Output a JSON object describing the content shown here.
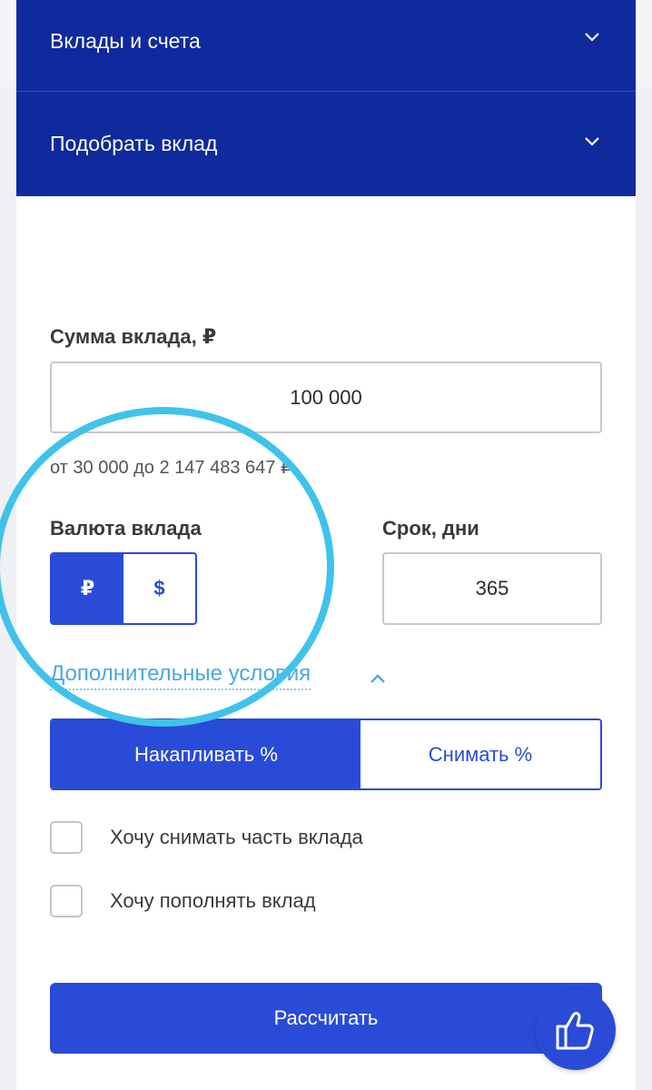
{
  "accordion": {
    "item1_label": "Вклады и счета",
    "item2_label": "Подобрать вклад"
  },
  "amount": {
    "label": "Сумма вклада, ₽",
    "value": "100 000",
    "hint": "от 30 000 до 2 147 483 647 ₽"
  },
  "currency": {
    "label": "Валюта вклада",
    "options": [
      "₽",
      "$"
    ],
    "selected": "₽"
  },
  "term": {
    "label": "Срок, дни",
    "value": "365"
  },
  "extra_conditions_link": "Дополнительные условия",
  "interest_mode": {
    "options": [
      "Накапливать %",
      "Снимать %"
    ],
    "selected": "Накапливать %"
  },
  "checkboxes": [
    {
      "label": "Хочу снимать часть вклада",
      "checked": false
    },
    {
      "label": "Хочу пополнять вклад",
      "checked": false
    }
  ],
  "calculate_button": "Рассчитать",
  "fab_icon": "thumbs-up-icon",
  "colors": {
    "header_blue": "#0f2a9c",
    "accent_blue": "#2a4bd7",
    "link_blue": "#4aa8e0",
    "highlight_cyan": "#3fc3ea"
  }
}
